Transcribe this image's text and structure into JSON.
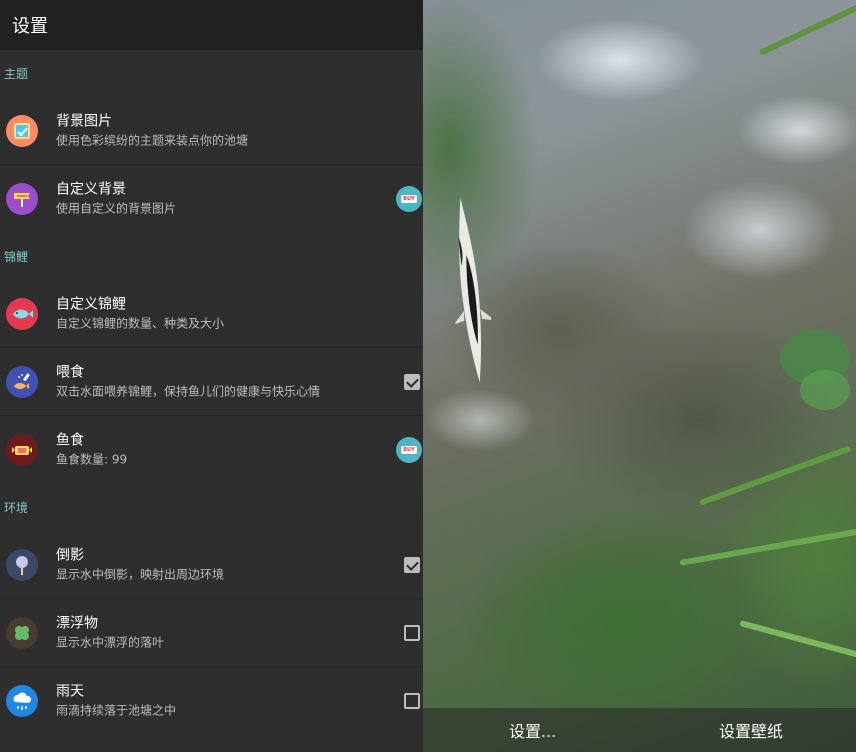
{
  "toolbar": {
    "title": "设置"
  },
  "sections": [
    {
      "header": "主题",
      "items": [
        {
          "title": "背景图片",
          "subtitle": "使用色彩缤纷的主题来装点你的池塘",
          "icon": "palette-icon",
          "control": "none"
        },
        {
          "title": "自定义背景",
          "subtitle": "使用自定义的背景图片",
          "icon": "signpost-icon",
          "control": "buy"
        }
      ]
    },
    {
      "header": "锦鲤",
      "items": [
        {
          "title": "自定义锦鲤",
          "subtitle": "自定义锦鲤的数量、种类及大小",
          "icon": "fish-icon",
          "control": "none"
        },
        {
          "title": "喂食",
          "subtitle": "双击水面喂养锦鲤，保持鱼儿们的健康与快乐心情",
          "icon": "feeding-icon",
          "control": "checkbox",
          "checked": true
        },
        {
          "title": "鱼食",
          "subtitle": "鱼食数量: 99",
          "icon": "fish-food-icon",
          "control": "buy"
        }
      ]
    },
    {
      "header": "环境",
      "items": [
        {
          "title": "倒影",
          "subtitle": "显示水中倒影，映射出周边环境",
          "icon": "reflection-icon",
          "control": "checkbox",
          "checked": true
        },
        {
          "title": "漂浮物",
          "subtitle": "显示水中漂浮的落叶",
          "icon": "leaf-icon",
          "control": "checkbox",
          "checked": false
        },
        {
          "title": "雨天",
          "subtitle": "雨滴持续落于池塘之中",
          "icon": "rain-icon",
          "control": "checkbox",
          "checked": false
        }
      ]
    }
  ],
  "buy_badge_label": "BUY",
  "bottom_bar": {
    "settings_label": "设置...",
    "set_wallpaper_label": "设置壁纸"
  },
  "colors": {
    "section_header": "#80cbc4",
    "buy_badge": "#4db6c2",
    "panel_bg": "#2e2e2e",
    "toolbar_bg": "#212121"
  }
}
